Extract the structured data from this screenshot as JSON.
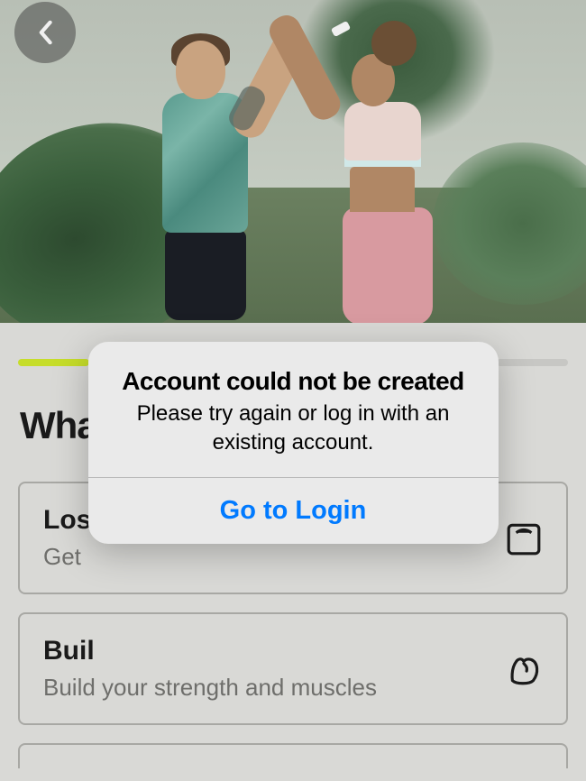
{
  "progress": {
    "total": 7,
    "active": 1
  },
  "title": "What's your goal?",
  "options": [
    {
      "title_prefix": "Los",
      "desc_prefix": "Get",
      "icon": "scale"
    },
    {
      "title_prefix": "Buil",
      "desc": "Build your strength and muscles",
      "icon": "muscle"
    }
  ],
  "modal": {
    "title": "Account could not be created",
    "message": "Please try again or log in with an existing account.",
    "button": "Go to Login"
  }
}
